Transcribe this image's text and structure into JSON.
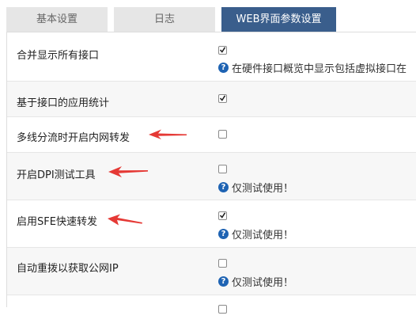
{
  "tabs": [
    {
      "label": "基本设置",
      "active": false
    },
    {
      "label": "日志",
      "active": false
    },
    {
      "label": "WEB界面参数设置",
      "active": true
    }
  ],
  "settings": [
    {
      "label": "合并显示所有接口",
      "checked": true,
      "help": "在硬件接口概览中显示包括虚拟接口在"
    },
    {
      "label": "基于接口的应用统计",
      "checked": true,
      "help": ""
    },
    {
      "label": "多线分流时开启内网转发",
      "checked": false,
      "help": ""
    },
    {
      "label": "开启DPI测试工具",
      "checked": false,
      "help": "仅测试使用！"
    },
    {
      "label": "启用SFE快速转发",
      "checked": true,
      "help": "仅测试使用！"
    },
    {
      "label": "自动重拨以获取公网IP",
      "checked": false,
      "help": "仅测试使用！"
    }
  ],
  "colors": {
    "active_tab": "#3a5e8c",
    "help_icon": "#1e63b3",
    "arrow": "#e53935"
  },
  "icons": {
    "help": "question-circle-icon",
    "annotation": "red-arrow-icon"
  }
}
